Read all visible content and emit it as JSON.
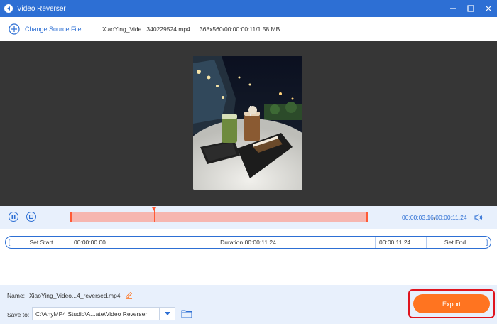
{
  "window": {
    "title": "Video Reverser",
    "controls": [
      "minimize-icon",
      "maximize-icon",
      "close-icon"
    ]
  },
  "toolbar": {
    "change_source_label": "Change Source File",
    "file_name": "XiaoYing_Vide...340229524.mp4",
    "file_meta": "368x560/00:00:00:11/1.58 MB"
  },
  "preview": {
    "thumbnail": "night cafe table with drinks and cake"
  },
  "playback": {
    "current_time": "00:00:03.16",
    "separator": "/",
    "total_time": "00:00:11.24",
    "progress": 0.28
  },
  "trim": {
    "open_bracket": "[",
    "set_start_label": "Set Start",
    "start_value": "00:00:00.00",
    "duration_label": "Duration:00:00:11.24",
    "end_value": "00:00:11.24",
    "set_end_label": "Set End",
    "close_bracket": "]"
  },
  "output": {
    "name_label": "Name:",
    "name_value": "XiaoYing_Video...4_reversed.mp4",
    "save_to_label": "Save to:",
    "save_path": "C:\\AnyMP4 Studio\\A...ate\\Video Reverser",
    "export_label": "Export"
  },
  "colors": {
    "accent": "#2d6fd4",
    "export": "#ff7420",
    "highlight": "#e0141e",
    "timeline": "#ff5a36"
  }
}
